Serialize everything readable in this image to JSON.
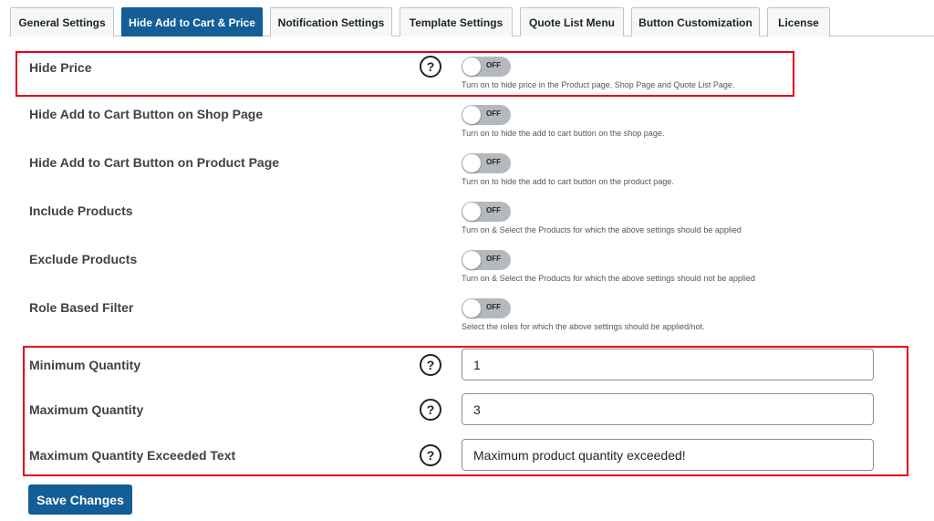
{
  "tabs": [
    {
      "label": "General Settings",
      "active": false
    },
    {
      "label": "Hide Add to Cart & Price",
      "active": true
    },
    {
      "label": "Notification Settings",
      "active": false
    },
    {
      "label": "Template Settings",
      "active": false
    },
    {
      "label": "Quote List Menu",
      "active": false
    },
    {
      "label": "Button Customization",
      "active": false
    },
    {
      "label": "License",
      "active": false
    }
  ],
  "help_symbol": "?",
  "toggles": [
    {
      "label": "Hide Price",
      "state": "OFF",
      "description": "Turn on to hide price in the Product page, Shop Page and Quote List Page."
    },
    {
      "label": "Hide Add to Cart Button on Shop Page",
      "state": "OFF",
      "description": "Turn on to hide the add to cart button on the shop page."
    },
    {
      "label": "Hide Add to Cart Button on Product Page",
      "state": "OFF",
      "description": "Turn on to hide the add to cart button on the product page."
    },
    {
      "label": "Include Products",
      "state": "OFF",
      "description": "Turn on & Select the Products for which the above settings should be applied"
    },
    {
      "label": "Exclude Products",
      "state": "OFF",
      "description": "Turn on & Select the Products for which the above settings should not be applied"
    },
    {
      "label": "Role Based Filter",
      "state": "OFF",
      "description": "Select the roles for which the above settings should be applied/not."
    }
  ],
  "fields": [
    {
      "label": "Minimum Quantity",
      "value": "1"
    },
    {
      "label": "Maximum Quantity",
      "value": "3"
    },
    {
      "label": "Maximum Quantity Exceeded Text",
      "value": "Maximum product quantity exceeded!"
    }
  ],
  "save_label": "Save Changes",
  "colors": {
    "accent": "#135e96",
    "highlight": "#e3000f",
    "toggle_off": "#b6b9bc"
  }
}
